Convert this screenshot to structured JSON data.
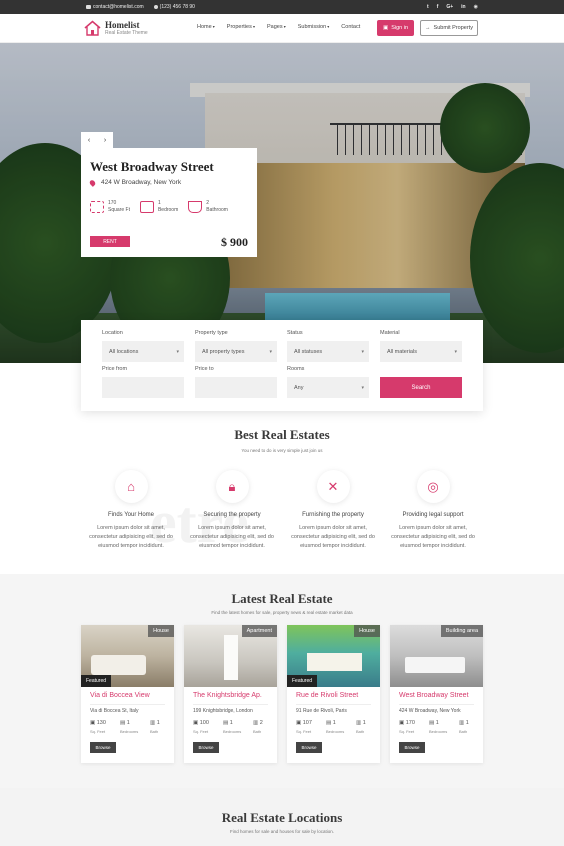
{
  "topbar": {
    "email": "contact@homelist.com",
    "phone": "(123) 456 78 90",
    "social": [
      "t",
      "f",
      "G+",
      "in",
      "◉"
    ]
  },
  "logo": {
    "name": "Homelist",
    "tagline": "Real Estate Theme"
  },
  "menu": [
    "Home",
    "Properties",
    "Pages",
    "Submission",
    "Contact"
  ],
  "buttons": {
    "signin": "Sign in",
    "submit": "Submit Property"
  },
  "hero": {
    "title": "West Broadway Street",
    "address": "424 W Broadway, New York",
    "features": [
      {
        "value": "170",
        "label": "Square Ft"
      },
      {
        "value": "1",
        "label": "Bedroom"
      },
      {
        "value": "2",
        "label": "Bathroom"
      }
    ],
    "status": "RENT",
    "price": "$ 900",
    "prev": "‹",
    "next": "›"
  },
  "search": {
    "fields": [
      {
        "label": "Location",
        "value": "All locations"
      },
      {
        "label": "Property type",
        "value": "All property types"
      },
      {
        "label": "Status",
        "value": "All statuses"
      },
      {
        "label": "Material",
        "value": "All materials"
      },
      {
        "label": "Price from",
        "value": ""
      },
      {
        "label": "Price to",
        "value": ""
      },
      {
        "label": "Rooms",
        "value": "Any"
      }
    ],
    "button": "Search"
  },
  "best": {
    "title": "Best Real Estates",
    "subtitle": "You need to do is very simple just join us",
    "ghost": "etre",
    "services": [
      {
        "title": "Finds Your Home",
        "desc": "Lorem ipsum dolor sit amet, consectetur adipisicing elit, sed do eiusmod tempor incididunt."
      },
      {
        "title": "Securing the property",
        "desc": "Lorem ipsum dolor sit amet, consectetur adipisicing elit, sed do eiusmod tempor incididunt."
      },
      {
        "title": "Furnishing the property",
        "desc": "Lorem ipsum dolor sit amet, consectetur adipisicing elit, sed do eiusmod tempor incididunt."
      },
      {
        "title": "Providing legal support",
        "desc": "Lorem ipsum dolor sit amet, consectetur adipisicing elit, sed do eiusmod tempor incididunt."
      }
    ]
  },
  "latest": {
    "title": "Latest Real Estate",
    "subtitle": "Find the latest homes for sale, property news & real estate market data",
    "stat_labels": [
      "Sq. Feet",
      "Bedrooms",
      "Bath"
    ],
    "browse": "Browse",
    "featured": "Featured",
    "cards": [
      {
        "type": "House",
        "title": "Via di Boccea View",
        "address": "Via di Boccea St, Italy",
        "sqft": "130",
        "bed": "1",
        "bath": "1",
        "featured": true
      },
      {
        "type": "Apartment",
        "title": "The Knightsbridge Ap.",
        "address": "199 Knightsbridge, London",
        "sqft": "100",
        "bed": "1",
        "bath": "2",
        "featured": false
      },
      {
        "type": "House",
        "title": "Rue de Rivoli Street",
        "address": "91 Rue de Rivoli, Paris",
        "sqft": "107",
        "bed": "1",
        "bath": "1",
        "featured": true
      },
      {
        "type": "Building area",
        "title": "West Broadway Street",
        "address": "424 W Broadway, New York",
        "sqft": "170",
        "bed": "1",
        "bath": "1",
        "featured": false
      }
    ]
  },
  "locations": {
    "title": "Real Estate Locations",
    "subtitle": "Find homes for sale and houses for sale by location."
  },
  "colors": {
    "accent": "#d63a6c",
    "dark": "#333333"
  }
}
